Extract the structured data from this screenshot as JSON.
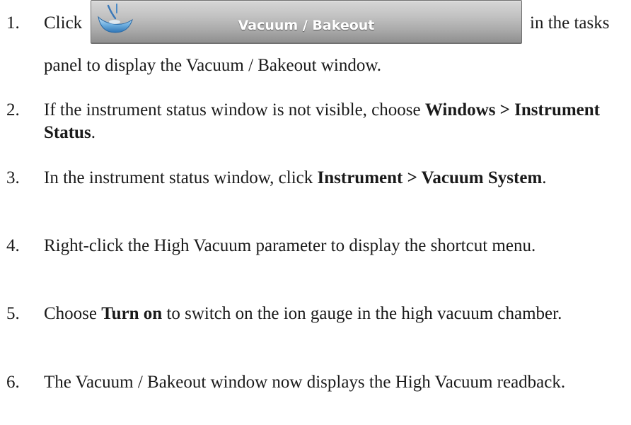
{
  "steps": [
    {
      "number": "1.",
      "text_before": "Click",
      "button": {
        "icon": "vacuum-bakeout-icon",
        "label": "Vacuum / Bakeout"
      },
      "text_after": "in the tasks",
      "text_line2": "panel to display the Vacuum / Bakeout window."
    },
    {
      "number": "2.",
      "t1": "If the instrument status window is not visible, choose ",
      "b1": "Windows > Instrument Status",
      "t2": "."
    },
    {
      "number": "3.",
      "t1": "In the instrument status window, click ",
      "b1": "Instrument > Vacuum System",
      "t2": "."
    },
    {
      "number": "4.",
      "t1": "Right-click the High Vacuum parameter to display the shortcut menu."
    },
    {
      "number": "5.",
      "t1": "Choose ",
      "b1": "Turn on",
      "t2": " to switch on the ion gauge in the high vacuum chamber."
    },
    {
      "number": "6.",
      "t1": "The Vacuum / Bakeout window now displays the High Vacuum readback."
    }
  ],
  "colors": {
    "text": "#1a1a1a",
    "button_top": "#d6d6d6",
    "button_bottom": "#8e8e8e",
    "button_text": "#ffffff"
  }
}
